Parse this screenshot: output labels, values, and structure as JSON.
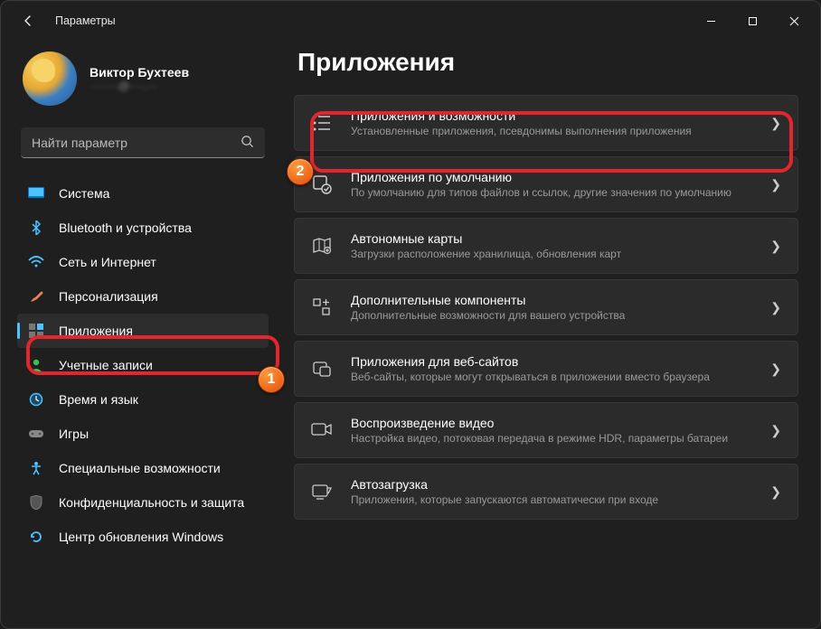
{
  "window": {
    "title": "Параметры"
  },
  "profile": {
    "name": "Виктор Бухтеев",
    "sub": "········@····.···"
  },
  "search": {
    "placeholder": "Найти параметр"
  },
  "sidebar": {
    "items": [
      {
        "label": "Система"
      },
      {
        "label": "Bluetooth и устройства"
      },
      {
        "label": "Сеть и Интернет"
      },
      {
        "label": "Персонализация"
      },
      {
        "label": "Приложения"
      },
      {
        "label": "Учетные записи"
      },
      {
        "label": "Время и язык"
      },
      {
        "label": "Игры"
      },
      {
        "label": "Специальные возможности"
      },
      {
        "label": "Конфиденциальность и защита"
      },
      {
        "label": "Центр обновления Windows"
      }
    ]
  },
  "page": {
    "title": "Приложения"
  },
  "cards": [
    {
      "title": "Приложения и возможности",
      "sub": "Установленные приложения, псевдонимы выполнения приложения"
    },
    {
      "title": "Приложения по умолчанию",
      "sub": "По умолчанию для типов файлов и ссылок, другие значения по умолчанию"
    },
    {
      "title": "Автономные карты",
      "sub": "Загрузки расположение хранилища, обновления карт"
    },
    {
      "title": "Дополнительные компоненты",
      "sub": "Дополнительные возможности для вашего устройства"
    },
    {
      "title": "Приложения для веб-сайтов",
      "sub": "Веб-сайты, которые могут открываться в приложении вместо браузера"
    },
    {
      "title": "Воспроизведение видео",
      "sub": "Настройка видео, потоковая передача в режиме HDR, параметры батареи"
    },
    {
      "title": "Автозагрузка",
      "sub": "Приложения, которые запускаются автоматически при входе"
    }
  ],
  "annotations": {
    "b1": "1",
    "b2": "2"
  }
}
